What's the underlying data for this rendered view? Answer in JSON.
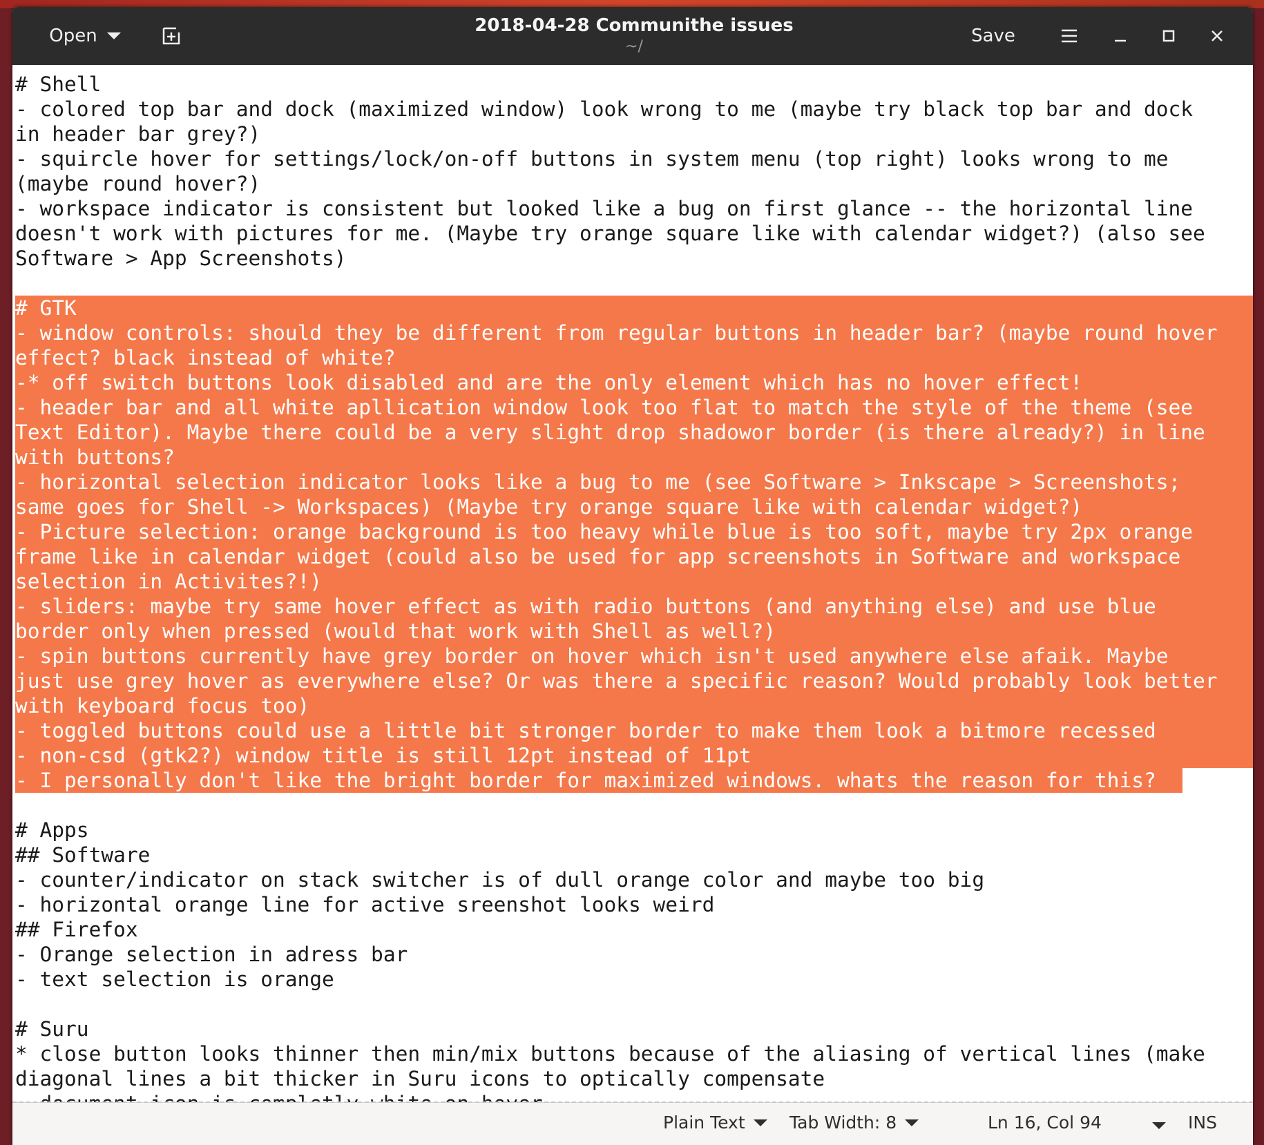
{
  "window": {
    "title": "2018-04-28 Communithe issues",
    "subtitle": "~/",
    "open_label": "Open",
    "save_label": "Save",
    "accent": "#f5784a"
  },
  "editor": {
    "lines": [
      {
        "text": "# Shell",
        "sel": false
      },
      {
        "text": "- colored top bar and dock (maximized window) look wrong to me (maybe try black top bar and dock",
        "sel": false
      },
      {
        "text": "in header bar grey?)",
        "sel": false
      },
      {
        "text": "- squircle hover for settings/lock/on-off buttons in system menu (top right) looks wrong to me",
        "sel": false
      },
      {
        "text": "(maybe round hover?)",
        "sel": false
      },
      {
        "text": "- workspace indicator is consistent but looked like a bug on first glance -- the horizontal line",
        "sel": false
      },
      {
        "text": "doesn't work with pictures for me. (Maybe try orange square like with calendar widget?) (also see",
        "sel": false
      },
      {
        "text": "Software > App Screenshots)",
        "sel": false
      },
      {
        "text": "",
        "sel": false
      },
      {
        "text": "# GTK",
        "sel": true
      },
      {
        "text": "- window controls: should they be different from regular buttons in header bar? (maybe round hover",
        "sel": true
      },
      {
        "text": "effect? black instead of white?",
        "sel": true
      },
      {
        "text": "-* off switch buttons look disabled and are the only element which has no hover effect!",
        "sel": true
      },
      {
        "text": "- header bar and all white apllication window look too flat to match the style of the theme (see",
        "sel": true
      },
      {
        "text": "Text Editor). Maybe there could be a very slight drop shadowor border (is there already?) in line",
        "sel": true
      },
      {
        "text": "with buttons?",
        "sel": true
      },
      {
        "text": "- horizontal selection indicator looks like a bug to me (see Software > Inkscape > Screenshots;",
        "sel": true
      },
      {
        "text": "same goes for Shell -> Workspaces) (Maybe try orange square like with calendar widget?)",
        "sel": true
      },
      {
        "text": "- Picture selection: orange background is too heavy while blue is too soft, maybe try 2px orange",
        "sel": true
      },
      {
        "text": "frame like in calendar widget (could also be used for app screenshots in Software and workspace",
        "sel": true
      },
      {
        "text": "selection in Activites?!)",
        "sel": true
      },
      {
        "text": "- sliders: maybe try same hover effect as with radio buttons (and anything else) and use blue",
        "sel": true
      },
      {
        "text": "border only when pressed (would that work with Shell as well?)",
        "sel": true
      },
      {
        "text": "- spin buttons currently have grey border on hover which isn't used anywhere else afaik. Maybe",
        "sel": true
      },
      {
        "text": "just use grey hover as everywhere else? Or was there a specific reason? Would probably look better",
        "sel": true
      },
      {
        "text": "with keyboard focus too)",
        "sel": true
      },
      {
        "text": "- toggled buttons could use a little bit stronger border to make them look a bitmore recessed",
        "sel": true
      },
      {
        "text": "- non-csd (gtk2?) window title is still 12pt instead of 11pt",
        "sel": true
      },
      {
        "text": "- I personally don't like the bright border for maximized windows. whats the reason for this?",
        "sel": true,
        "last": true
      },
      {
        "text": "",
        "sel": false
      },
      {
        "text": "# Apps",
        "sel": false
      },
      {
        "text": "## Software",
        "sel": false
      },
      {
        "text": "- counter/indicator on stack switcher is of dull orange color and maybe too big",
        "sel": false
      },
      {
        "text": "- horizontal orange line for active sreenshot looks weird",
        "sel": false
      },
      {
        "text": "## Firefox",
        "sel": false
      },
      {
        "text": "- Orange selection in adress bar",
        "sel": false
      },
      {
        "text": "- text selection is orange",
        "sel": false
      },
      {
        "text": "",
        "sel": false
      },
      {
        "text": "# Suru",
        "sel": false
      },
      {
        "text": "* close button looks thinner then min/mix buttons because of the aliasing of vertical lines (make",
        "sel": false
      },
      {
        "text": "diagonal lines a bit thicker in Suru icons to optically compensate",
        "sel": false
      },
      {
        "text": "- document icon is completly white on hover",
        "sel": false
      }
    ]
  },
  "statusbar": {
    "language": "Plain Text",
    "tab_width": "Tab Width: 8",
    "cursor": "Ln 16, Col 94",
    "mode": "INS"
  }
}
